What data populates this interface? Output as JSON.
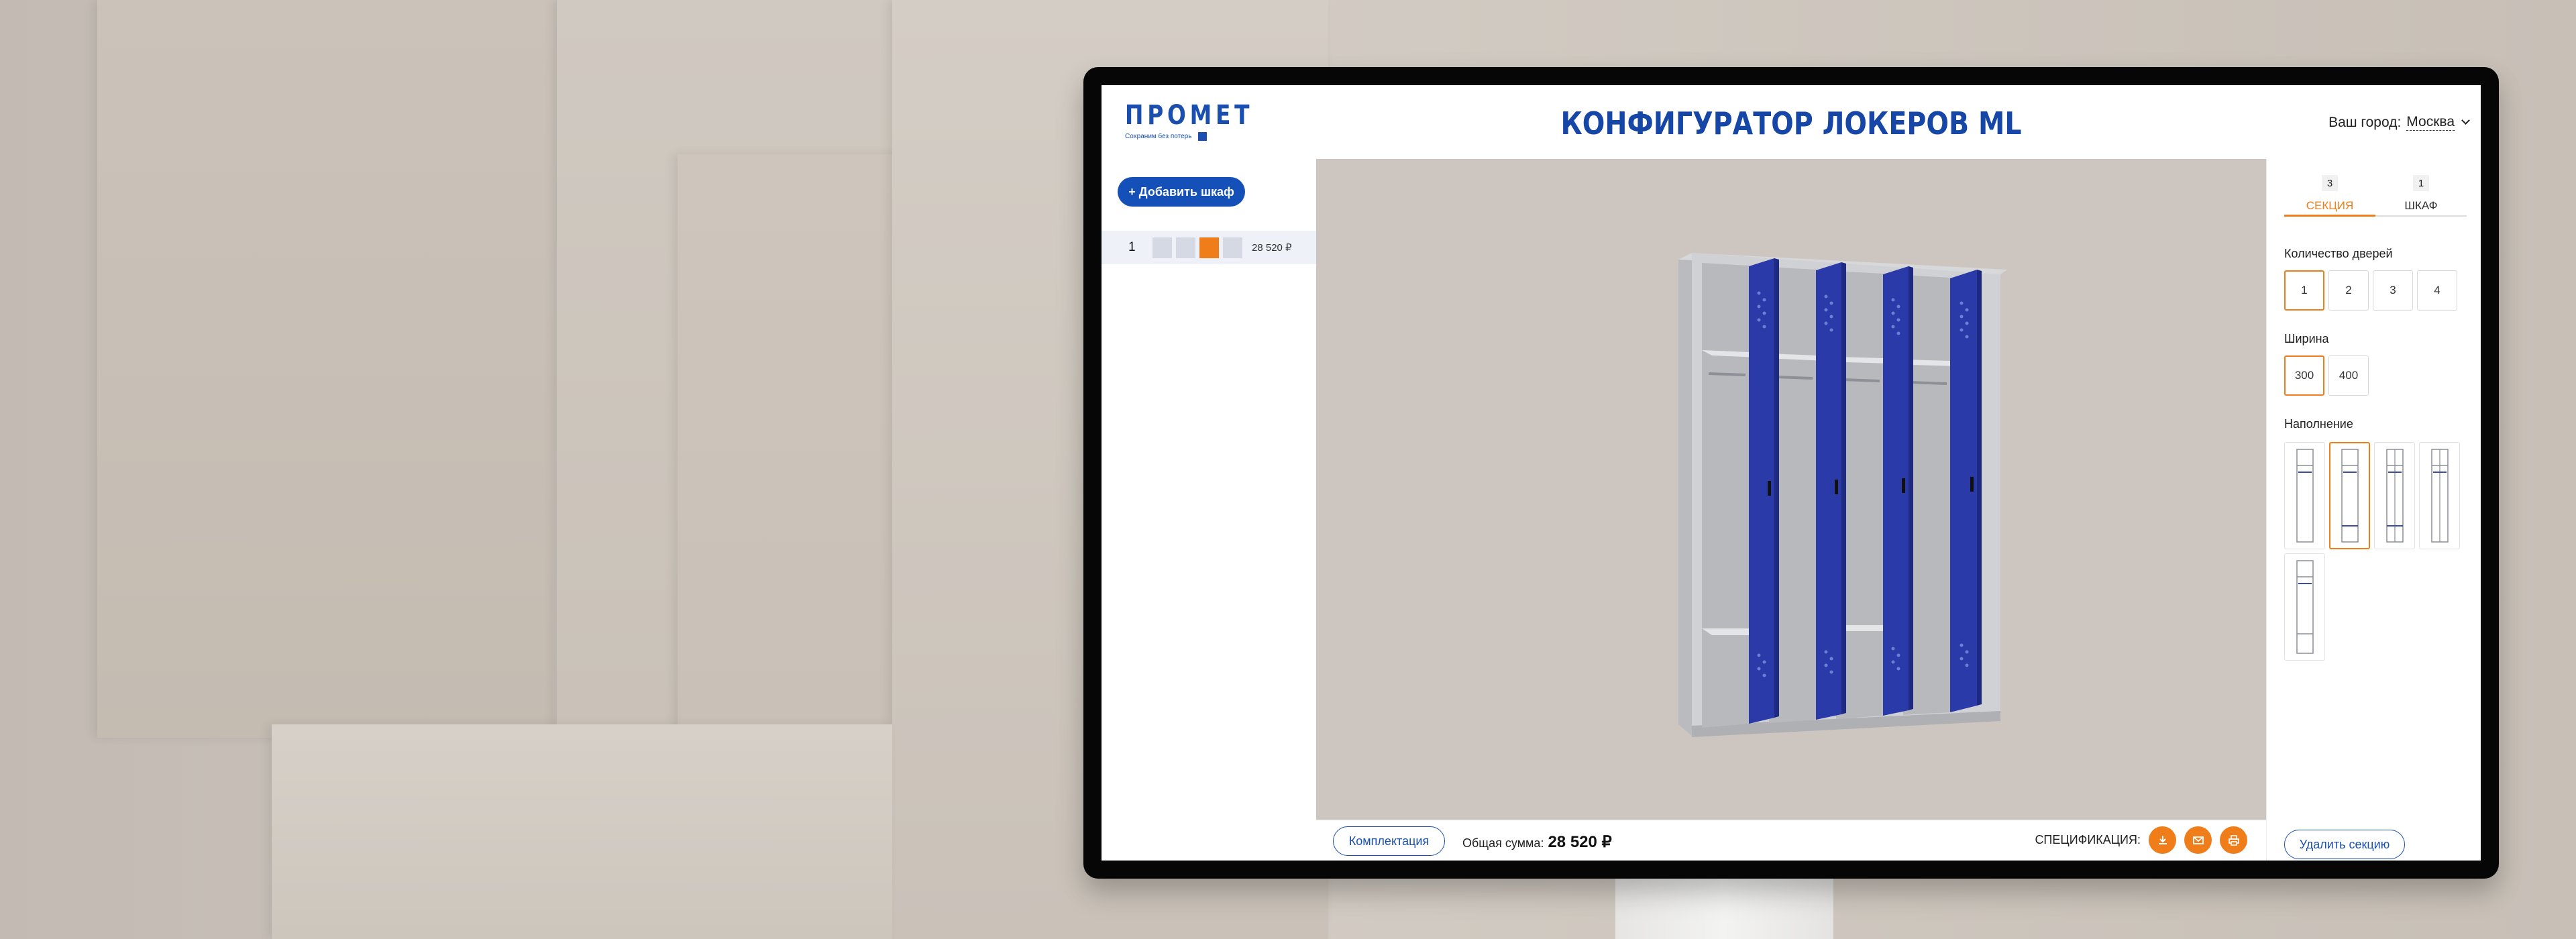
{
  "header": {
    "logo_word": "ПРОМЕТ",
    "logo_tagline": "Сохраним без потерь",
    "title": "КОНФИГУРАТОР ЛОКЕРОВ ML",
    "city_label": "Ваш город:",
    "city_value": "Москва"
  },
  "sidebar": {
    "add_button": "+ Добавить шкаф",
    "cabinets": [
      {
        "number": "1",
        "price": "28 520 ₽"
      }
    ]
  },
  "bottom": {
    "komplekt_button": "Комплектация",
    "total_label": "Общая сумма:",
    "total_value": "28 520 ₽",
    "spec_label": "СПЕЦИФИКАЦИЯ:",
    "spec_icons": [
      "download-icon",
      "mail-icon",
      "print-icon"
    ]
  },
  "right_panel": {
    "tabs": [
      {
        "count": "3",
        "label": "СЕКЦИЯ"
      },
      {
        "count": "1",
        "label": "ШКАФ"
      }
    ],
    "doors_label": "Количество дверей",
    "doors_options": [
      "1",
      "2",
      "3",
      "4"
    ],
    "width_label": "Ширина",
    "width_options": [
      "300",
      "400"
    ],
    "fill_label": "Наполнение",
    "delete_button": "Удалить секцию"
  },
  "colors": {
    "brand_blue": "#1a4fb0",
    "accent_orange": "#ef7d1a",
    "door_blue": "#2a3aa8",
    "body_grey": "#c9cbce"
  }
}
